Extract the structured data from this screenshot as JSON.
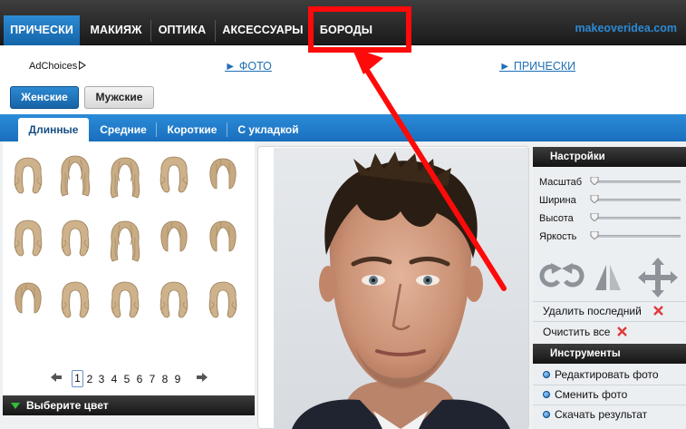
{
  "nav": {
    "tabs": [
      {
        "label": "ПРИЧЕСКИ",
        "active": true
      },
      {
        "label": "МАКИЯЖ",
        "active": false
      },
      {
        "label": "ОПТИКА",
        "active": false
      },
      {
        "label": "АКСЕССУАРЫ",
        "active": false
      },
      {
        "label": "БОРОДЫ",
        "active": false
      }
    ],
    "brand": "makeoveridea.com"
  },
  "ad": {
    "adchoices": "AdChoices",
    "link_photo": "► ФОТО",
    "link_hair": "► ПРИЧЕСКИ"
  },
  "gender": {
    "female": "Женские",
    "male": "Мужские",
    "selected": "female"
  },
  "subtabs": [
    {
      "label": "Длинные",
      "active": true
    },
    {
      "label": "Средние",
      "active": false
    },
    {
      "label": "Короткие",
      "active": false
    },
    {
      "label": "С укладкой",
      "active": false
    }
  ],
  "gallery": {
    "item_count": 15,
    "pages": [
      "1",
      "2",
      "3",
      "4",
      "5",
      "6",
      "7",
      "8",
      "9"
    ],
    "current_page": "1"
  },
  "color_bar": "Выберите цвет",
  "settings": {
    "title": "Настройки",
    "sliders": [
      {
        "label": "Масштаб",
        "value": 0
      },
      {
        "label": "Ширина",
        "value": 0
      },
      {
        "label": "Высота",
        "value": 0
      },
      {
        "label": "Яркость",
        "value": 0
      }
    ],
    "delete_last": "Удалить последний",
    "clear_all": "Очистить все"
  },
  "tools": {
    "title": "Инструменты",
    "items": [
      "Редактировать фото",
      "Сменить фото",
      "Скачать результат"
    ]
  },
  "colors": {
    "accent_blue": "#1a6fbd",
    "annotation_red": "#ff0a0a",
    "hair_blonde": "#c9ad86"
  }
}
